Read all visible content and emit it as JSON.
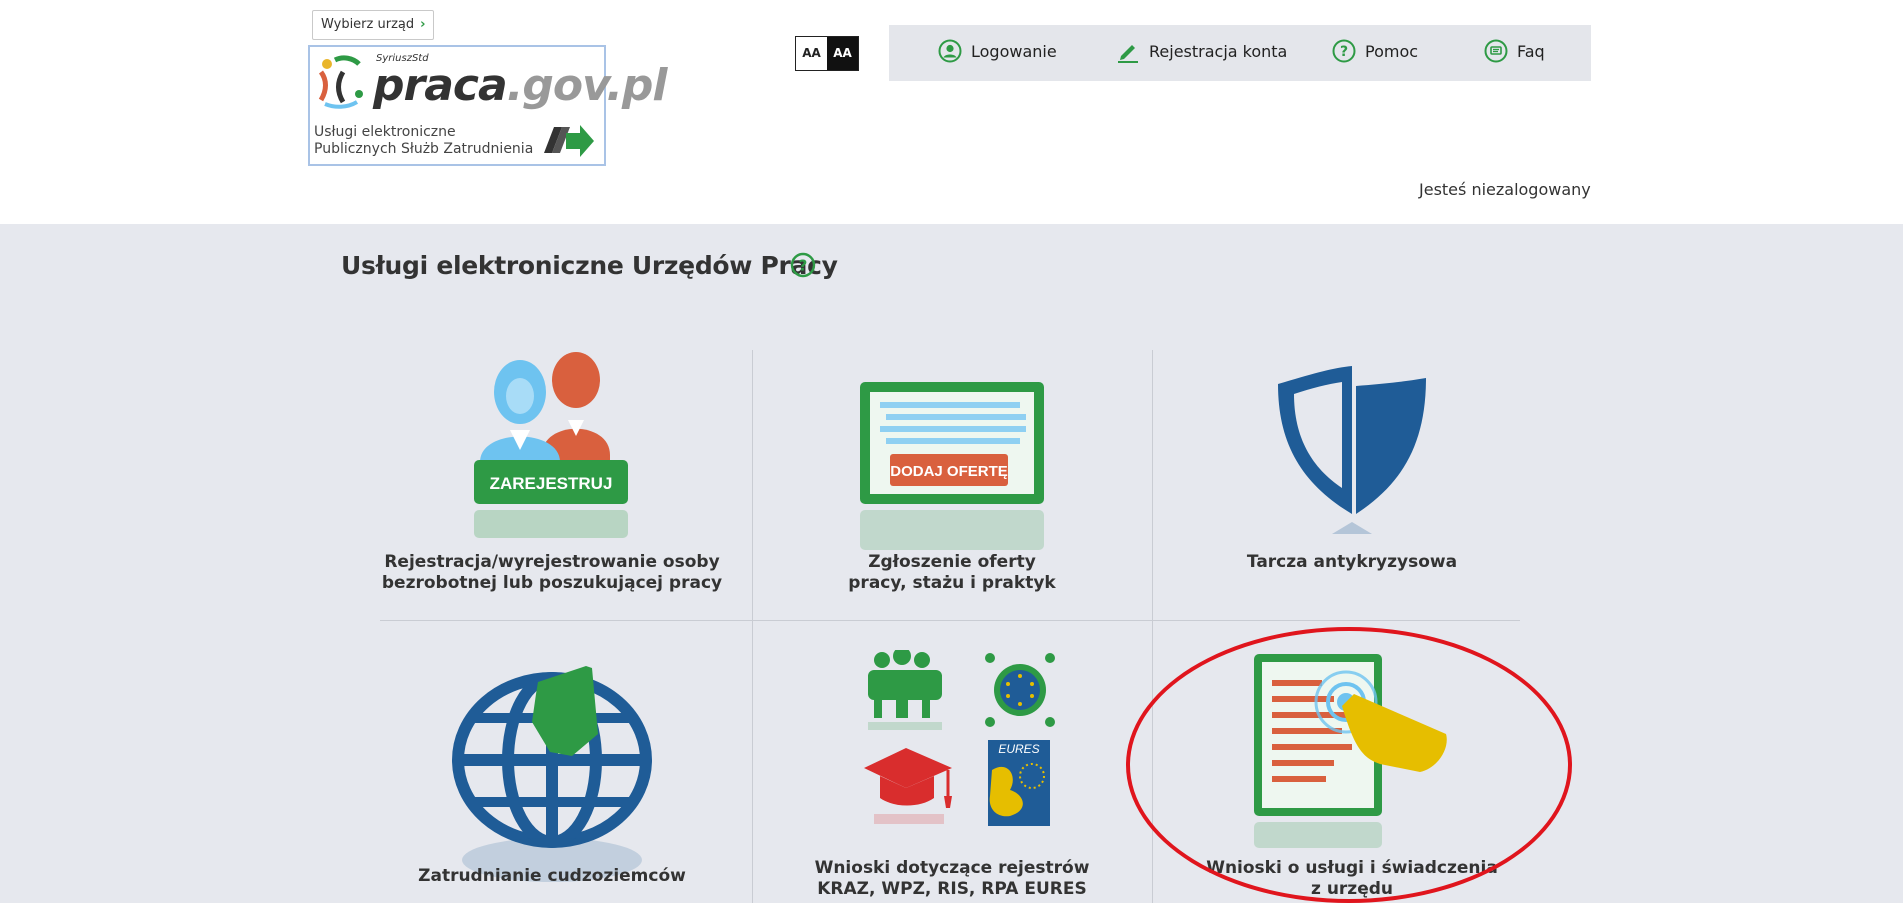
{
  "header": {
    "office_button": "Wybierz urząd",
    "logo": {
      "superscript": "SyriuszStd",
      "word_primary": "praca",
      "word_secondary": ".gov.pl",
      "subtitle_line1": "Usługi elektroniczne",
      "subtitle_line2": "Publicznych Służb Zatrudnienia"
    },
    "contrast": [
      "AA",
      "AA"
    ],
    "nav": [
      {
        "label": "Logowanie",
        "icon": "user-icon"
      },
      {
        "label": "Rejestracja konta",
        "icon": "pencil-icon"
      },
      {
        "label": "Pomoc",
        "icon": "help-icon"
      },
      {
        "label": "Faq",
        "icon": "chat-icon"
      }
    ],
    "login_status": "Jesteś niezalogowany"
  },
  "main": {
    "title": "Usługi elektroniczne Urzędów Pracy",
    "tiles": [
      {
        "label": "Rejestracja/wyrejestrowanie osoby bezrobotnej lub poszukującej pracy",
        "line1": "Rejestracja/wyrejestrowanie osoby",
        "line2": "bezrobotnej lub poszukującej pracy",
        "button": "ZAREJESTRUJ"
      },
      {
        "label": "Zgłoszenie oferty pracy, stażu i praktyk",
        "line1": "Zgłoszenie oferty",
        "line2": "pracy, stażu i praktyk",
        "button": "DODAJ OFERTĘ"
      },
      {
        "label": "Tarcza antykryzysowa",
        "line1": "Tarcza antykryzysowa",
        "line2": ""
      },
      {
        "label": "Zatrudnianie cudzoziemców",
        "line1": "Zatrudnianie cudzoziemców",
        "line2": ""
      },
      {
        "label": "Wnioski dotyczące rejestrów KRAZ, WPZ, RIS, RPA EURES",
        "line1": "Wnioski dotyczące rejestrów",
        "line2": "KRAZ, WPZ, RIS, RPA EURES",
        "eures": "EURES"
      },
      {
        "label": "Wnioski o usługi i świadczenia z urzędu",
        "line1": "Wnioski o usługi i świadczenia",
        "line2": "z urzędu"
      }
    ]
  },
  "colors": {
    "green": "#2e9a45",
    "blue": "#1f5c97",
    "orange": "#d9603e",
    "light_blue": "#6ec3f0",
    "yellow": "#e6be00",
    "red_highlight": "#e0151d",
    "background": "#e6e8ee"
  }
}
